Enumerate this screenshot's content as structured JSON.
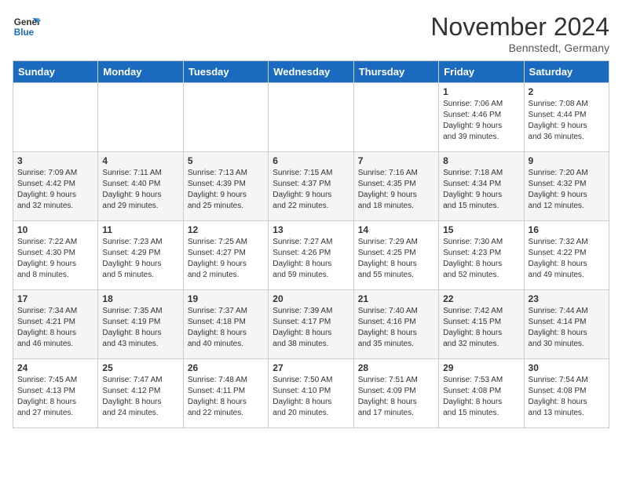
{
  "header": {
    "logo_general": "General",
    "logo_blue": "Blue",
    "month_title": "November 2024",
    "location": "Bennstedt, Germany"
  },
  "days_of_week": [
    "Sunday",
    "Monday",
    "Tuesday",
    "Wednesday",
    "Thursday",
    "Friday",
    "Saturday"
  ],
  "weeks": [
    [
      {
        "day": "",
        "info": ""
      },
      {
        "day": "",
        "info": ""
      },
      {
        "day": "",
        "info": ""
      },
      {
        "day": "",
        "info": ""
      },
      {
        "day": "",
        "info": ""
      },
      {
        "day": "1",
        "info": "Sunrise: 7:06 AM\nSunset: 4:46 PM\nDaylight: 9 hours\nand 39 minutes."
      },
      {
        "day": "2",
        "info": "Sunrise: 7:08 AM\nSunset: 4:44 PM\nDaylight: 9 hours\nand 36 minutes."
      }
    ],
    [
      {
        "day": "3",
        "info": "Sunrise: 7:09 AM\nSunset: 4:42 PM\nDaylight: 9 hours\nand 32 minutes."
      },
      {
        "day": "4",
        "info": "Sunrise: 7:11 AM\nSunset: 4:40 PM\nDaylight: 9 hours\nand 29 minutes."
      },
      {
        "day": "5",
        "info": "Sunrise: 7:13 AM\nSunset: 4:39 PM\nDaylight: 9 hours\nand 25 minutes."
      },
      {
        "day": "6",
        "info": "Sunrise: 7:15 AM\nSunset: 4:37 PM\nDaylight: 9 hours\nand 22 minutes."
      },
      {
        "day": "7",
        "info": "Sunrise: 7:16 AM\nSunset: 4:35 PM\nDaylight: 9 hours\nand 18 minutes."
      },
      {
        "day": "8",
        "info": "Sunrise: 7:18 AM\nSunset: 4:34 PM\nDaylight: 9 hours\nand 15 minutes."
      },
      {
        "day": "9",
        "info": "Sunrise: 7:20 AM\nSunset: 4:32 PM\nDaylight: 9 hours\nand 12 minutes."
      }
    ],
    [
      {
        "day": "10",
        "info": "Sunrise: 7:22 AM\nSunset: 4:30 PM\nDaylight: 9 hours\nand 8 minutes."
      },
      {
        "day": "11",
        "info": "Sunrise: 7:23 AM\nSunset: 4:29 PM\nDaylight: 9 hours\nand 5 minutes."
      },
      {
        "day": "12",
        "info": "Sunrise: 7:25 AM\nSunset: 4:27 PM\nDaylight: 9 hours\nand 2 minutes."
      },
      {
        "day": "13",
        "info": "Sunrise: 7:27 AM\nSunset: 4:26 PM\nDaylight: 8 hours\nand 59 minutes."
      },
      {
        "day": "14",
        "info": "Sunrise: 7:29 AM\nSunset: 4:25 PM\nDaylight: 8 hours\nand 55 minutes."
      },
      {
        "day": "15",
        "info": "Sunrise: 7:30 AM\nSunset: 4:23 PM\nDaylight: 8 hours\nand 52 minutes."
      },
      {
        "day": "16",
        "info": "Sunrise: 7:32 AM\nSunset: 4:22 PM\nDaylight: 8 hours\nand 49 minutes."
      }
    ],
    [
      {
        "day": "17",
        "info": "Sunrise: 7:34 AM\nSunset: 4:21 PM\nDaylight: 8 hours\nand 46 minutes."
      },
      {
        "day": "18",
        "info": "Sunrise: 7:35 AM\nSunset: 4:19 PM\nDaylight: 8 hours\nand 43 minutes."
      },
      {
        "day": "19",
        "info": "Sunrise: 7:37 AM\nSunset: 4:18 PM\nDaylight: 8 hours\nand 40 minutes."
      },
      {
        "day": "20",
        "info": "Sunrise: 7:39 AM\nSunset: 4:17 PM\nDaylight: 8 hours\nand 38 minutes."
      },
      {
        "day": "21",
        "info": "Sunrise: 7:40 AM\nSunset: 4:16 PM\nDaylight: 8 hours\nand 35 minutes."
      },
      {
        "day": "22",
        "info": "Sunrise: 7:42 AM\nSunset: 4:15 PM\nDaylight: 8 hours\nand 32 minutes."
      },
      {
        "day": "23",
        "info": "Sunrise: 7:44 AM\nSunset: 4:14 PM\nDaylight: 8 hours\nand 30 minutes."
      }
    ],
    [
      {
        "day": "24",
        "info": "Sunrise: 7:45 AM\nSunset: 4:13 PM\nDaylight: 8 hours\nand 27 minutes."
      },
      {
        "day": "25",
        "info": "Sunrise: 7:47 AM\nSunset: 4:12 PM\nDaylight: 8 hours\nand 24 minutes."
      },
      {
        "day": "26",
        "info": "Sunrise: 7:48 AM\nSunset: 4:11 PM\nDaylight: 8 hours\nand 22 minutes."
      },
      {
        "day": "27",
        "info": "Sunrise: 7:50 AM\nSunset: 4:10 PM\nDaylight: 8 hours\nand 20 minutes."
      },
      {
        "day": "28",
        "info": "Sunrise: 7:51 AM\nSunset: 4:09 PM\nDaylight: 8 hours\nand 17 minutes."
      },
      {
        "day": "29",
        "info": "Sunrise: 7:53 AM\nSunset: 4:08 PM\nDaylight: 8 hours\nand 15 minutes."
      },
      {
        "day": "30",
        "info": "Sunrise: 7:54 AM\nSunset: 4:08 PM\nDaylight: 8 hours\nand 13 minutes."
      }
    ]
  ]
}
